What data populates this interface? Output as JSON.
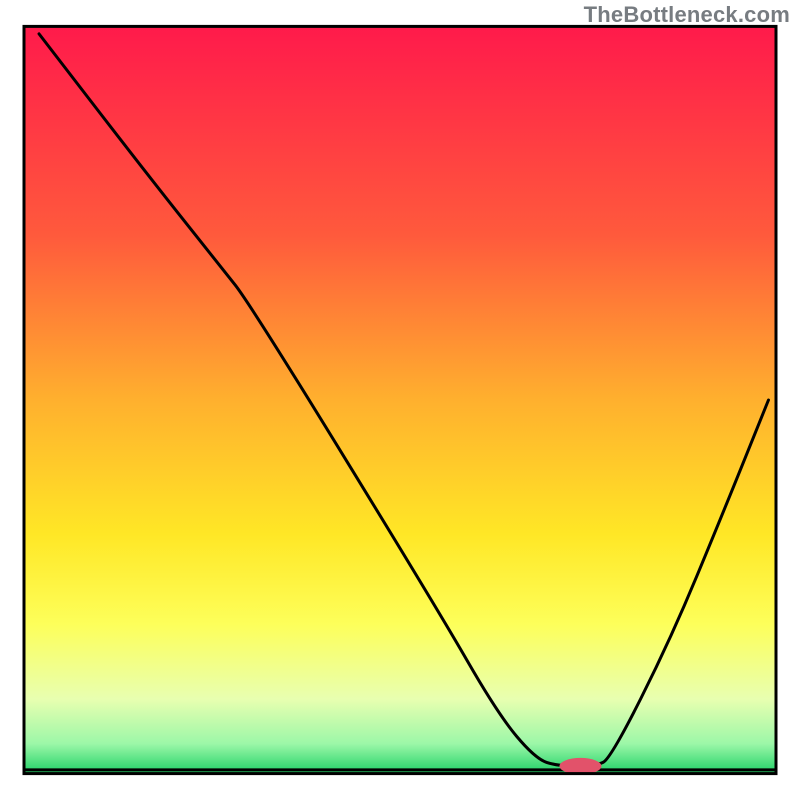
{
  "watermark": "TheBottleneck.com",
  "chart_data": {
    "type": "line",
    "title": "",
    "xlabel": "",
    "ylabel": "",
    "xlim": [
      0,
      100
    ],
    "ylim": [
      0,
      100
    ],
    "gradient_stops": [
      {
        "offset": 0,
        "color": "#ff1a4b"
      },
      {
        "offset": 28,
        "color": "#ff5a3c"
      },
      {
        "offset": 50,
        "color": "#ffb02e"
      },
      {
        "offset": 68,
        "color": "#ffe726"
      },
      {
        "offset": 80,
        "color": "#fdff5a"
      },
      {
        "offset": 90,
        "color": "#e8ffb0"
      },
      {
        "offset": 96,
        "color": "#9cf7a8"
      },
      {
        "offset": 100,
        "color": "#1fd166"
      }
    ],
    "curve_points": [
      {
        "x": 2,
        "y": 99
      },
      {
        "x": 15,
        "y": 82
      },
      {
        "x": 26,
        "y": 68
      },
      {
        "x": 30,
        "y": 63
      },
      {
        "x": 55,
        "y": 22
      },
      {
        "x": 63,
        "y": 8
      },
      {
        "x": 68,
        "y": 2
      },
      {
        "x": 71,
        "y": 1
      },
      {
        "x": 76,
        "y": 1
      },
      {
        "x": 78,
        "y": 2
      },
      {
        "x": 86,
        "y": 18
      },
      {
        "x": 93,
        "y": 35
      },
      {
        "x": 99,
        "y": 50
      }
    ],
    "baseline_y": 0.5,
    "marker": {
      "x": 74,
      "y": 1,
      "rx": 2.8,
      "ry": 1.1,
      "color": "#e2526a"
    },
    "frame": {
      "x": 3,
      "y": 3.3,
      "w": 94,
      "h": 93.4
    }
  }
}
